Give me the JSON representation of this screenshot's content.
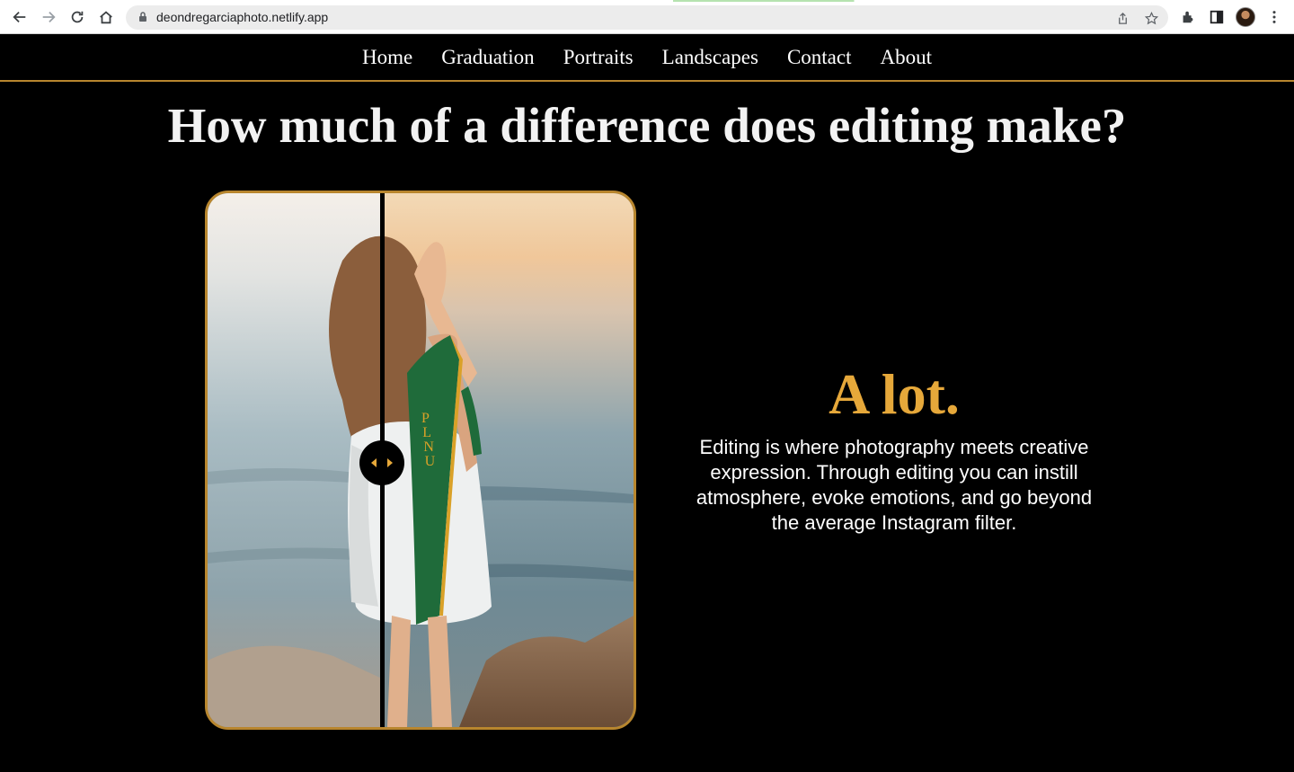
{
  "browser": {
    "url": "deondregarciaphoto.netlify.app",
    "icons": [
      "back-arrow-icon",
      "forward-arrow-icon",
      "reload-icon",
      "home-icon",
      "lock-icon",
      "share-icon",
      "star-icon",
      "extensions-icon",
      "sidepanel-icon",
      "profile-avatar",
      "menu-dots-icon"
    ]
  },
  "nav": {
    "items": [
      "Home",
      "Graduation",
      "Portraits",
      "Landscapes",
      "Contact",
      "About"
    ]
  },
  "headline": "How much of a difference does editing make?",
  "comparison": {
    "stole_text": "PLNU",
    "slider_position": 0.41
  },
  "answer": {
    "title": "A lot.",
    "body": "Editing is where photography meets creative expression. Through editing you can instill atmosphere, evoke emotions, and go beyond the average Instagram filter."
  },
  "colors": {
    "accent_gold": "#e6a83a",
    "border_gold": "#b8862e",
    "background": "#000000"
  }
}
